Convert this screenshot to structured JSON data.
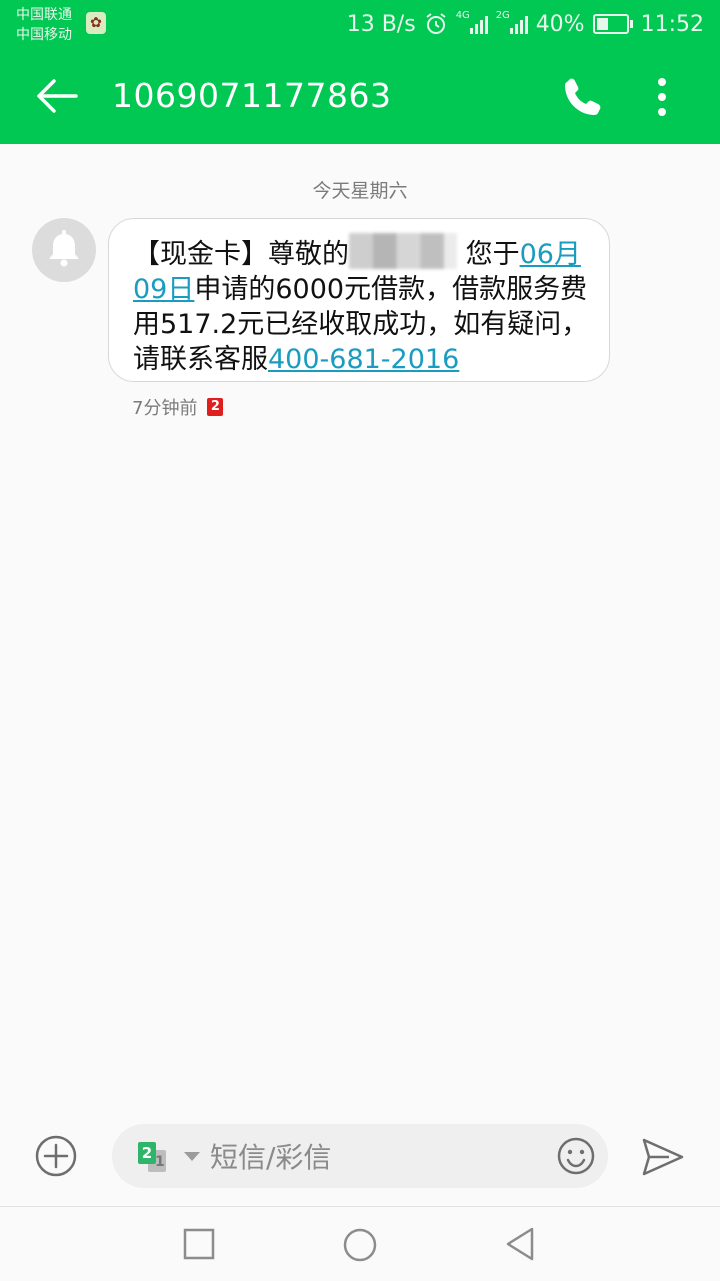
{
  "status_bar": {
    "carrier_1": "中国联通",
    "carrier_2": "中国移动",
    "net_speed": "13 B/s",
    "net_4g": "4G",
    "net_2g": "2G",
    "battery_text": "40%",
    "battery_level": 0.4,
    "time": "11:52"
  },
  "app_bar": {
    "title": "1069071177863",
    "back_icon": "arrow-left-icon",
    "call_icon": "phone-icon",
    "more_icon": "more-vert-icon"
  },
  "conversation": {
    "date_separator": "今天星期六",
    "message": {
      "part_1": "【现金卡】尊敬的",
      "part_2": "您于",
      "link_date": "06月09日",
      "part_3": "申请的6000元借款，借款服务费用517.2元已经收取成功，如有疑问，请联系客服",
      "link_phone": "400-681-2016"
    },
    "timestamp": "7分钟前",
    "sim_badge": "2"
  },
  "composer": {
    "sim_front": "2",
    "sim_back": "1",
    "placeholder": "短信/彩信"
  },
  "colors": {
    "accent": "#00c853",
    "link": "#1a9cc0",
    "sim_badge": "#e01e1e"
  }
}
